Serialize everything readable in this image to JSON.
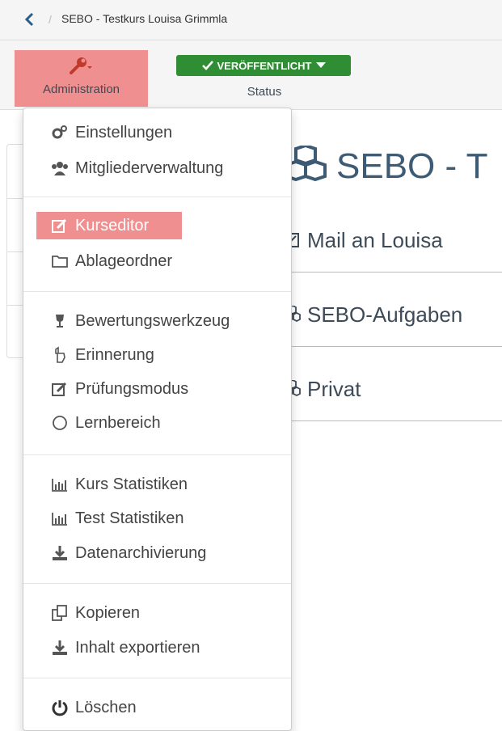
{
  "breadcrumb": {
    "separator": "/",
    "course_title": "SEBO - Testkurs Louisa Grimmla"
  },
  "toolbar": {
    "admin_label": "Administration",
    "status_button": "VERÖFFENTLICHT",
    "status_label": "Status"
  },
  "course": {
    "title": "SEBO - T",
    "nodes": [
      {
        "label": "Mail an Louisa",
        "icon": "mail-icon"
      },
      {
        "label": "SEBO-Aufgaben",
        "icon": "cubes-icon"
      },
      {
        "label": "Privat",
        "icon": "cubes-icon"
      }
    ]
  },
  "menu": {
    "groups": [
      [
        {
          "label": "Einstellungen",
          "icon": "cogs-icon"
        },
        {
          "label": "Mitgliederverwaltung",
          "icon": "users-icon"
        }
      ],
      [
        {
          "label": "Kurseditor",
          "icon": "edit-icon",
          "active": true
        },
        {
          "label": "Ablageordner",
          "icon": "folder-icon"
        }
      ],
      [
        {
          "label": "Bewertungswerkzeug",
          "icon": "trophy-icon"
        },
        {
          "label": "Erinnerung",
          "icon": "hand-pointer-icon"
        },
        {
          "label": "Prüfungsmodus",
          "icon": "edit-icon"
        },
        {
          "label": "Lernbereich",
          "icon": "circle-icon"
        }
      ],
      [
        {
          "label": "Kurs Statistiken",
          "icon": "bar-chart-icon"
        },
        {
          "label": "Test Statistiken",
          "icon": "bar-chart-icon"
        },
        {
          "label": "Datenarchivierung",
          "icon": "download-icon"
        }
      ],
      [
        {
          "label": "Kopieren",
          "icon": "copy-icon"
        },
        {
          "label": "Inhalt exportieren",
          "icon": "download-icon"
        }
      ],
      [
        {
          "label": "Löschen",
          "icon": "power-icon"
        }
      ]
    ]
  },
  "colors": {
    "highlight": "#f08f8f",
    "status_green": "#2f8d34",
    "title_blue": "#3d5b74"
  }
}
